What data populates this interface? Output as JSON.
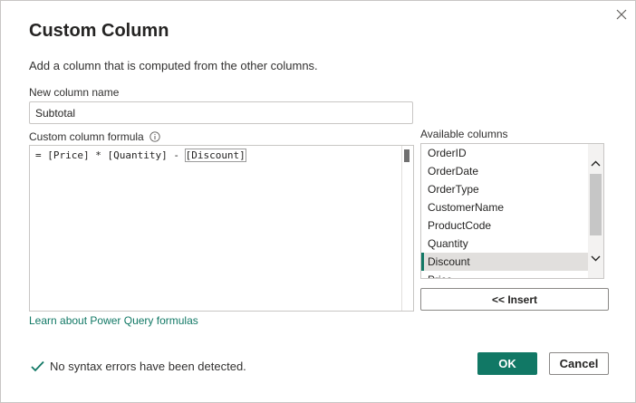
{
  "dialog": {
    "title": "Custom Column",
    "description": "Add a column that is computed from the other columns.",
    "close_icon": "close-icon"
  },
  "new_column": {
    "label": "New column name",
    "value": "Subtotal"
  },
  "formula": {
    "label": "Custom column formula",
    "info_icon": "info-icon",
    "text_before": "= [Price] * [Quantity] - ",
    "text_caret": "[Discount]",
    "text_after": ""
  },
  "available_columns": {
    "label": "Available columns",
    "items": [
      "OrderID",
      "OrderDate",
      "OrderType",
      "CustomerName",
      "ProductCode",
      "Quantity",
      "Discount",
      "Price"
    ],
    "selected": "Discount",
    "insert_label": "<< Insert"
  },
  "learn_link": "Learn about Power Query formulas",
  "status": {
    "icon": "checkmark-icon",
    "text": "No syntax errors have been detected."
  },
  "buttons": {
    "ok": "OK",
    "cancel": "Cancel"
  },
  "colors": {
    "accent": "#117865",
    "selected_bg": "#e1dfdd",
    "border": "#c8c6c4"
  }
}
